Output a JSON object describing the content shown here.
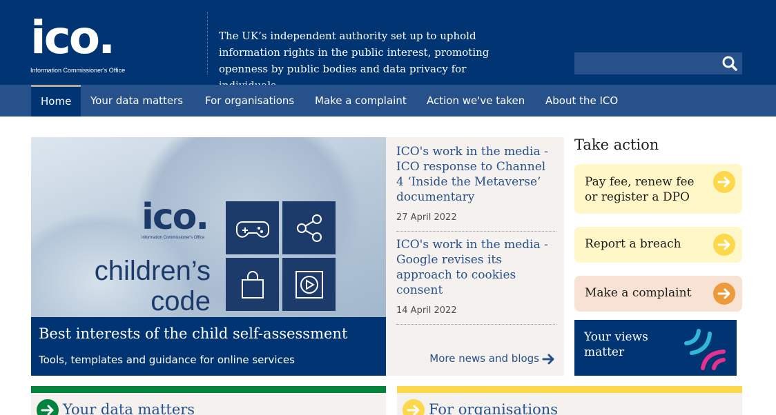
{
  "header": {
    "logo_text": "ico.",
    "logo_subtitle": "Information Commissioner's Office",
    "tagline": "The UK’s independent authority set up to uphold information rights in the public interest, promoting openness by public bodies and data privacy for individuals.",
    "search_placeholder": "",
    "search_icon": "search-icon"
  },
  "nav": {
    "items": [
      {
        "label": "Home",
        "active": true
      },
      {
        "label": "Your data matters"
      },
      {
        "label": "For organisations"
      },
      {
        "label": "Make a complaint"
      },
      {
        "label": "Action we've taken"
      },
      {
        "label": "About the ICO"
      }
    ]
  },
  "hero": {
    "image_logo": "ico.",
    "image_logo_sub": "Information Commissioner's Office",
    "image_text": "children’s code",
    "tile_icons": [
      "gamepad-icon",
      "share-icon",
      "shopping-bag-icon",
      "play-icon"
    ],
    "title": "Best interests of the child self-assessment",
    "subtitle": "Tools, templates and guidance for online services"
  },
  "news": {
    "items": [
      {
        "title": "ICO's work in the media - ICO response to Channel 4 ‘Inside the Metaverse’ documentary",
        "date": "27 April 2022"
      },
      {
        "title": "ICO's work in the media - Google revises its approach to cookies consent",
        "date": "14 April 2022"
      }
    ],
    "more_label": "More news and blogs"
  },
  "take_action": {
    "heading": "Take action",
    "cards": [
      {
        "label": "Pay fee, renew fee or register a DPO",
        "bg": "#fff7c8",
        "arrow": "#fcd84a"
      },
      {
        "label": "Report a breach",
        "bg": "#fff7c8",
        "arrow": "#fcd84a"
      },
      {
        "label": "Make a complaint",
        "bg": "#f8e2d3",
        "arrow": "#ec9a3c"
      }
    ],
    "views_label": "Your views matter"
  },
  "bottom_cards": [
    {
      "title": "Your data matters",
      "color": "#00843d"
    },
    {
      "title": "For organisations",
      "color": "#fcd84a"
    }
  ],
  "colors": {
    "header_bg": "#003473",
    "nav_bg": "#27518a",
    "link": "#27518a",
    "news_bg": "#f4f1ee"
  }
}
